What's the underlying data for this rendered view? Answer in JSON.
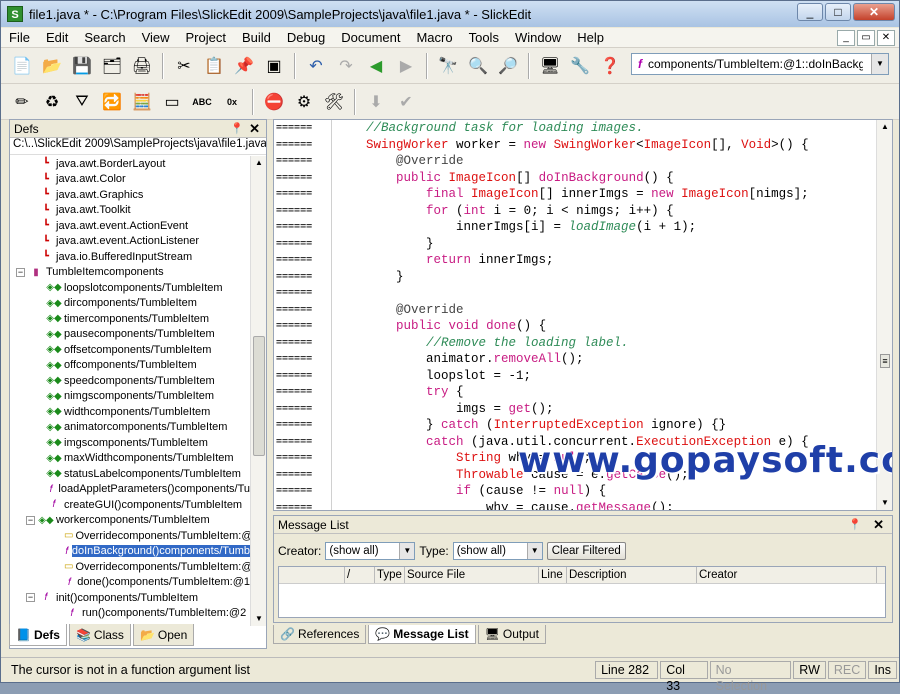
{
  "window": {
    "title": "file1.java * - C:\\Program Files\\SlickEdit 2009\\SampleProjects\\java\\file1.java * - SlickEdit",
    "app_icon": "S"
  },
  "menu": [
    "File",
    "Edit",
    "Search",
    "View",
    "Project",
    "Build",
    "Debug",
    "Document",
    "Macro",
    "Tools",
    "Window",
    "Help"
  ],
  "context_combo": "components/TumbleItem:@1::doInBackground",
  "defs": {
    "title": "Defs",
    "path": "C:\\..\\SlickEdit 2009\\SampleProjects\\java\\file1.java",
    "items": [
      {
        "label": "java.awt.BorderLayout",
        "icon": "import-icon",
        "indent": 28
      },
      {
        "label": "java.awt.Color",
        "icon": "import-icon",
        "indent": 28
      },
      {
        "label": "java.awt.Graphics",
        "icon": "import-icon",
        "indent": 28
      },
      {
        "label": "java.awt.Toolkit",
        "icon": "import-icon",
        "indent": 28
      },
      {
        "label": "java.awt.event.ActionEvent",
        "icon": "import-icon",
        "indent": 28
      },
      {
        "label": "java.awt.event.ActionListener",
        "icon": "import-icon",
        "indent": 28
      },
      {
        "label": "java.io.BufferedInputStream",
        "icon": "import-icon",
        "indent": 28
      },
      {
        "label": "TumbleItemcomponents",
        "icon": "class-icon",
        "indent": 18,
        "expander": "−"
      },
      {
        "label": "loopslotcomponents/TumbleItem",
        "icon": "field-icon",
        "indent": 36
      },
      {
        "label": "dircomponents/TumbleItem",
        "icon": "field-icon",
        "indent": 36
      },
      {
        "label": "timercomponents/TumbleItem",
        "icon": "field-icon",
        "indent": 36
      },
      {
        "label": "pausecomponents/TumbleItem",
        "icon": "field-icon",
        "indent": 36
      },
      {
        "label": "offsetcomponents/TumbleItem",
        "icon": "field-icon",
        "indent": 36
      },
      {
        "label": "offcomponents/TumbleItem",
        "icon": "field-icon",
        "indent": 36
      },
      {
        "label": "speedcomponents/TumbleItem",
        "icon": "field-icon",
        "indent": 36
      },
      {
        "label": "nimgscomponents/TumbleItem",
        "icon": "field-icon",
        "indent": 36
      },
      {
        "label": "widthcomponents/TumbleItem",
        "icon": "field-icon",
        "indent": 36
      },
      {
        "label": "animatorcomponents/TumbleItem",
        "icon": "field-icon",
        "indent": 36
      },
      {
        "label": "imgscomponents/TumbleItem",
        "icon": "field-icon",
        "indent": 36
      },
      {
        "label": "maxWidthcomponents/TumbleItem",
        "icon": "field-icon",
        "indent": 36
      },
      {
        "label": "statusLabelcomponents/TumbleItem",
        "icon": "field-icon",
        "indent": 36
      },
      {
        "label": "loadAppletParameters()components/Tu",
        "icon": "method-icon",
        "indent": 36
      },
      {
        "label": "createGUI()components/TumbleItem",
        "icon": "method-icon",
        "indent": 36
      },
      {
        "label": "workercomponents/TumbleItem",
        "icon": "field-icon",
        "indent": 28,
        "expander": "−"
      },
      {
        "label": "Overridecomponents/TumbleItem:@",
        "icon": "annotation-icon",
        "indent": 54
      },
      {
        "label": "doInBackground()components/Tumb",
        "icon": "function-icon",
        "indent": 54,
        "selected": true
      },
      {
        "label": "Overridecomponents/TumbleItem:@",
        "icon": "annotation-icon",
        "indent": 54
      },
      {
        "label": "done()components/TumbleItem:@1",
        "icon": "function-icon",
        "indent": 54
      },
      {
        "label": "init()components/TumbleItem",
        "icon": "function-icon",
        "indent": 28,
        "expander": "−"
      },
      {
        "label": "run()components/TumbleItem:@2",
        "icon": "function-icon",
        "indent": 54
      }
    ],
    "tabs": [
      "Defs",
      "Class",
      "Open"
    ]
  },
  "editor": {
    "gutter_mark": "======",
    "lines": [
      [
        [
          "    ",
          ""
        ],
        [
          "//Background task for loading images.",
          "cm"
        ]
      ],
      [
        [
          "    ",
          ""
        ],
        [
          "SwingWorker",
          "ty"
        ],
        [
          " worker = ",
          ""
        ],
        [
          "new",
          "kw"
        ],
        [
          " ",
          ""
        ],
        [
          "SwingWorker",
          "ty"
        ],
        [
          "<",
          ""
        ],
        [
          "ImageIcon",
          "ty"
        ],
        [
          "[], ",
          ""
        ],
        [
          "Void",
          "ty"
        ],
        [
          ">() {",
          ""
        ]
      ],
      [
        [
          "        ",
          ""
        ],
        [
          "@Override",
          "at"
        ]
      ],
      [
        [
          "        ",
          ""
        ],
        [
          "public",
          "kw"
        ],
        [
          " ",
          ""
        ],
        [
          "ImageIcon",
          "ty"
        ],
        [
          "[] ",
          ""
        ],
        [
          "doInBackground",
          "fn"
        ],
        [
          "() {",
          ""
        ]
      ],
      [
        [
          "            ",
          ""
        ],
        [
          "final",
          "kw"
        ],
        [
          " ",
          ""
        ],
        [
          "ImageIcon",
          "ty"
        ],
        [
          "[] innerImgs = ",
          ""
        ],
        [
          "new",
          "kw"
        ],
        [
          " ",
          ""
        ],
        [
          "ImageIcon",
          "ty"
        ],
        [
          "[nimgs];",
          ""
        ]
      ],
      [
        [
          "            ",
          ""
        ],
        [
          "for",
          "kw"
        ],
        [
          " (",
          ""
        ],
        [
          "int",
          "kw"
        ],
        [
          " i = 0; i < nimgs; i++) {",
          ""
        ]
      ],
      [
        [
          "                innerImgs[i] = ",
          ""
        ],
        [
          "loadImage",
          "cmi"
        ],
        [
          "(i + 1);",
          ""
        ]
      ],
      [
        [
          "            }",
          ""
        ]
      ],
      [
        [
          "            ",
          ""
        ],
        [
          "return",
          "kw"
        ],
        [
          " innerImgs;",
          ""
        ]
      ],
      [
        [
          "        }",
          ""
        ]
      ],
      [
        [
          "",
          ""
        ]
      ],
      [
        [
          "        ",
          ""
        ],
        [
          "@Override",
          "at"
        ]
      ],
      [
        [
          "        ",
          ""
        ],
        [
          "public",
          "kw"
        ],
        [
          " ",
          ""
        ],
        [
          "void",
          "kw"
        ],
        [
          " ",
          ""
        ],
        [
          "done",
          "fn"
        ],
        [
          "() {",
          ""
        ]
      ],
      [
        [
          "            ",
          ""
        ],
        [
          "//Remove the loading label.",
          "cm"
        ]
      ],
      [
        [
          "            animator.",
          ""
        ],
        [
          "removeAll",
          "fn"
        ],
        [
          "();",
          ""
        ]
      ],
      [
        [
          "            loopslot = -1;",
          ""
        ]
      ],
      [
        [
          "            ",
          ""
        ],
        [
          "try",
          "kw"
        ],
        [
          " {",
          ""
        ]
      ],
      [
        [
          "                imgs = ",
          ""
        ],
        [
          "get",
          "fn"
        ],
        [
          "();",
          ""
        ]
      ],
      [
        [
          "            } ",
          ""
        ],
        [
          "catch",
          "kw"
        ],
        [
          " (",
          ""
        ],
        [
          "InterruptedException",
          "ty"
        ],
        [
          " ignore) {}",
          ""
        ]
      ],
      [
        [
          "            ",
          ""
        ],
        [
          "catch",
          "kw"
        ],
        [
          " (java.util.concurrent.",
          ""
        ],
        [
          "ExecutionException",
          "ty"
        ],
        [
          " e) {",
          ""
        ]
      ],
      [
        [
          "                ",
          ""
        ],
        [
          "String",
          "ty"
        ],
        [
          " why = ",
          ""
        ],
        [
          "null",
          "kw"
        ],
        [
          ";",
          ""
        ]
      ],
      [
        [
          "                ",
          ""
        ],
        [
          "Throwable",
          "ty"
        ],
        [
          " cause = e.",
          ""
        ],
        [
          "getCause",
          "fn"
        ],
        [
          "();",
          ""
        ]
      ],
      [
        [
          "                ",
          ""
        ],
        [
          "if",
          "kw"
        ],
        [
          " (cause != ",
          ""
        ],
        [
          "null",
          "kw"
        ],
        [
          ") {",
          ""
        ]
      ],
      [
        [
          "                    why = cause.",
          ""
        ],
        [
          "getMessage",
          "fn"
        ],
        [
          "();",
          ""
        ]
      ]
    ]
  },
  "watermark": "www.gopaysoft.com",
  "message_list": {
    "title": "Message List",
    "creator_label": "Creator:",
    "creator_value": "(show all)",
    "type_label": "Type:",
    "type_value": "(show all)",
    "clear_button": "Clear Filtered",
    "columns": [
      "",
      "/",
      "Type",
      "Source File",
      "Line",
      "Description",
      "Creator"
    ]
  },
  "bottom_tabs": [
    "References",
    "Message List",
    "Output"
  ],
  "status": {
    "message": "The cursor is not in a function argument list",
    "line": "Line 282",
    "col": "Col 33",
    "selection": "No Selection",
    "rw": "RW",
    "rec": "REC",
    "ins": "Ins"
  }
}
